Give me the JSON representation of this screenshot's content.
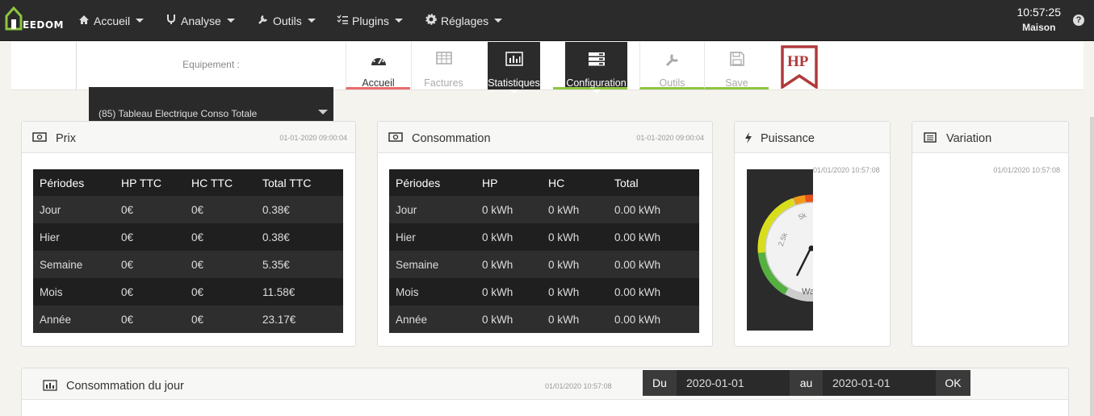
{
  "navbar": {
    "logo_text": "EEDOM",
    "items": [
      {
        "label": "Accueil",
        "icon": "home-icon"
      },
      {
        "label": "Analyse",
        "icon": "stethoscope-icon"
      },
      {
        "label": "Outils",
        "icon": "wrench-icon"
      },
      {
        "label": "Plugins",
        "icon": "tasks-icon"
      },
      {
        "label": "Réglages",
        "icon": "cogs-icon"
      }
    ],
    "time": "10:57:25",
    "location": "Maison",
    "help": "?"
  },
  "equipment": {
    "label": "Equipement :",
    "selected": "(85) Tableau Electrique Conso Totale"
  },
  "tabs": [
    {
      "label": "Accueil",
      "icon": "dashboard-icon"
    },
    {
      "label": "Factures",
      "icon": "table-icon"
    },
    {
      "label": "Statistiques",
      "icon": "bar-chart-icon"
    },
    {
      "label": "Configuration",
      "icon": "server-icon"
    },
    {
      "label": "Outils",
      "icon": "wrench-icon"
    },
    {
      "label": "Save",
      "icon": "floppy-icon"
    }
  ],
  "hp_badge": "HP",
  "prix": {
    "title": "Prix",
    "date": "01-01-2020 09:00:04",
    "headers": [
      "Périodes",
      "HP TTC",
      "HC TTC",
      "Total TTC"
    ],
    "rows": [
      [
        "Jour",
        "0€",
        "0€",
        "0.38€"
      ],
      [
        "Hier",
        "0€",
        "0€",
        "0.38€"
      ],
      [
        "Semaine",
        "0€",
        "0€",
        "5.35€"
      ],
      [
        "Mois",
        "0€",
        "0€",
        "11.58€"
      ],
      [
        "Année",
        "0€",
        "0€",
        "23.17€"
      ]
    ]
  },
  "consommation": {
    "title": "Consommation",
    "date": "01-01-2020 09:00:04",
    "headers": [
      "Périodes",
      "HP",
      "HC",
      "Total"
    ],
    "rows": [
      [
        "Jour",
        "0 kWh",
        "0 kWh",
        "0.00 kWh"
      ],
      [
        "Hier",
        "0 kWh",
        "0 kWh",
        "0.00 kWh"
      ],
      [
        "Semaine",
        "0 kWh",
        "0 kWh",
        "0.00 kWh"
      ],
      [
        "Mois",
        "0 kWh",
        "0 kWh",
        "0.00 kWh"
      ],
      [
        "Année",
        "0 kWh",
        "0 kWh",
        "0.00 kWh"
      ]
    ]
  },
  "puissance": {
    "title": "Puissance",
    "date": "01/01/2020 10:57:08",
    "gauge_ticks": [
      "2.5k",
      "5k"
    ],
    "gauge_unit": "Wa"
  },
  "variation": {
    "title": "Variation",
    "date": "01/01/2020 10:57:08"
  },
  "conso_jour": {
    "title": "Consommation du jour",
    "date": "01/01/2020 10:57:08",
    "du_label": "Du",
    "du_value": "2020-01-01",
    "au_label": "au",
    "au_value": "2020-01-01",
    "ok_label": "OK"
  }
}
